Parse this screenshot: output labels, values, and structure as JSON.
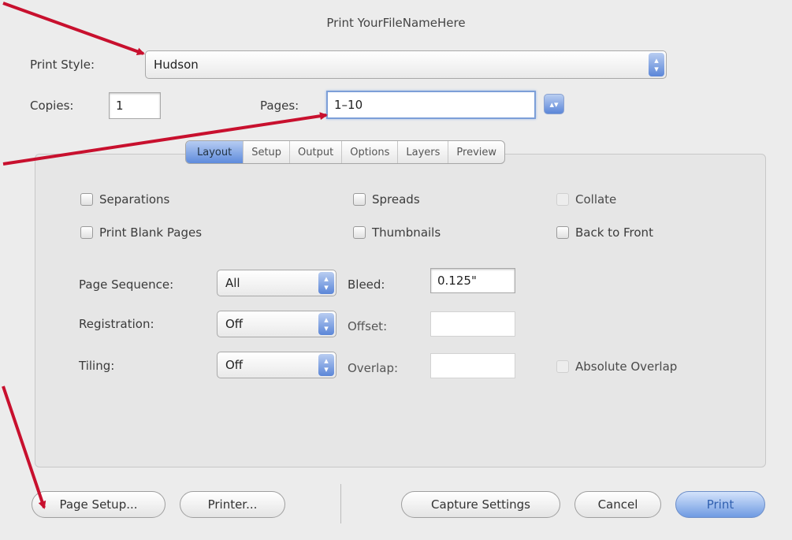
{
  "window": {
    "title": "Print YourFileNameHere"
  },
  "print_style": {
    "label": "Print Style:",
    "value": "Hudson"
  },
  "copies": {
    "label": "Copies:",
    "value": "1"
  },
  "pages": {
    "label": "Pages:",
    "value": "1–10"
  },
  "tabs": [
    "Layout",
    "Setup",
    "Output",
    "Options",
    "Layers",
    "Preview"
  ],
  "active_tab": "Layout",
  "checkboxes": {
    "separations": "Separations",
    "spreads": "Spreads",
    "collate": "Collate",
    "print_blank_pages": "Print Blank Pages",
    "thumbnails": "Thumbnails",
    "back_to_front": "Back to Front",
    "absolute_overlap": "Absolute Overlap"
  },
  "page_sequence": {
    "label": "Page Sequence:",
    "value": "All"
  },
  "registration": {
    "label": "Registration:",
    "value": "Off"
  },
  "tiling": {
    "label": "Tiling:",
    "value": "Off"
  },
  "bleed": {
    "label": "Bleed:",
    "value": "0.125\""
  },
  "offset": {
    "label": "Offset:",
    "value": ""
  },
  "overlap": {
    "label": "Overlap:",
    "value": ""
  },
  "buttons": {
    "page_setup": "Page Setup...",
    "printer": "Printer...",
    "capture_settings": "Capture Settings",
    "cancel": "Cancel",
    "print": "Print"
  },
  "colors": {
    "arrow": "#c8102e",
    "accent": "#6e9ae2"
  },
  "icons": {
    "popup": "stepper-arrows-icon"
  }
}
